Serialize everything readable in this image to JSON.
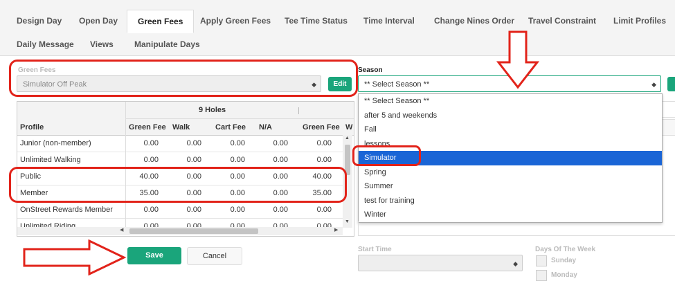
{
  "tabs_row1": [
    {
      "label": "Design Day"
    },
    {
      "label": "Open Day"
    },
    {
      "label": "Green Fees",
      "active": true
    },
    {
      "label": "Apply Green Fees"
    },
    {
      "label": "Tee Time Status"
    },
    {
      "label": "Time Interval"
    },
    {
      "label": "Change Nines Order"
    },
    {
      "label": "Travel Constraint"
    },
    {
      "label": "Limit Profiles"
    }
  ],
  "tabs_row2": [
    {
      "label": "Daily Message"
    },
    {
      "label": "Views"
    },
    {
      "label": "Manipulate Days"
    }
  ],
  "green_fees": {
    "label": "Green Fees",
    "selected": "Simulator Off Peak",
    "edit_label": "Edit"
  },
  "season": {
    "label": "Season",
    "selected": "** Select Season **",
    "options": [
      "** Select Season **",
      "after 5 and weekends",
      "Fall",
      "lessons",
      "Simulator",
      "Spring",
      "Summer",
      "test for training",
      "Winter"
    ],
    "highlighted_index": 4
  },
  "grid": {
    "group_header": "9 Holes",
    "columns": [
      "Profile",
      "Green Fee",
      "Walk",
      "Cart Fee",
      "N/A",
      "Green Fee",
      "W"
    ],
    "rows": [
      {
        "profile": "Junior (non-member)",
        "values": [
          "0.00",
          "0.00",
          "0.00",
          "0.00",
          "0.00"
        ]
      },
      {
        "profile": "Unlimited Walking",
        "values": [
          "0.00",
          "0.00",
          "0.00",
          "0.00",
          "0.00"
        ]
      },
      {
        "profile": "Public",
        "values": [
          "40.00",
          "0.00",
          "0.00",
          "0.00",
          "40.00"
        ]
      },
      {
        "profile": "Member",
        "values": [
          "35.00",
          "0.00",
          "0.00",
          "0.00",
          "35.00"
        ]
      },
      {
        "profile": "OnStreet Rewards Member",
        "values": [
          "0.00",
          "0.00",
          "0.00",
          "0.00",
          "0.00"
        ]
      },
      {
        "profile": "Unlimited Riding",
        "values": [
          "0.00",
          "0.00",
          "0.00",
          "0.00",
          "0.00"
        ]
      }
    ]
  },
  "actions": {
    "save_label": "Save",
    "cancel_label": "Cancel"
  },
  "start_time": {
    "label": "Start Time"
  },
  "days_of_week": {
    "label": "Days Of The Week",
    "days": [
      "Sunday",
      "Monday"
    ]
  },
  "colors": {
    "accent_green": "#1aa57b",
    "highlight_blue": "#1a65d6",
    "annotation_red": "#e2231a"
  }
}
